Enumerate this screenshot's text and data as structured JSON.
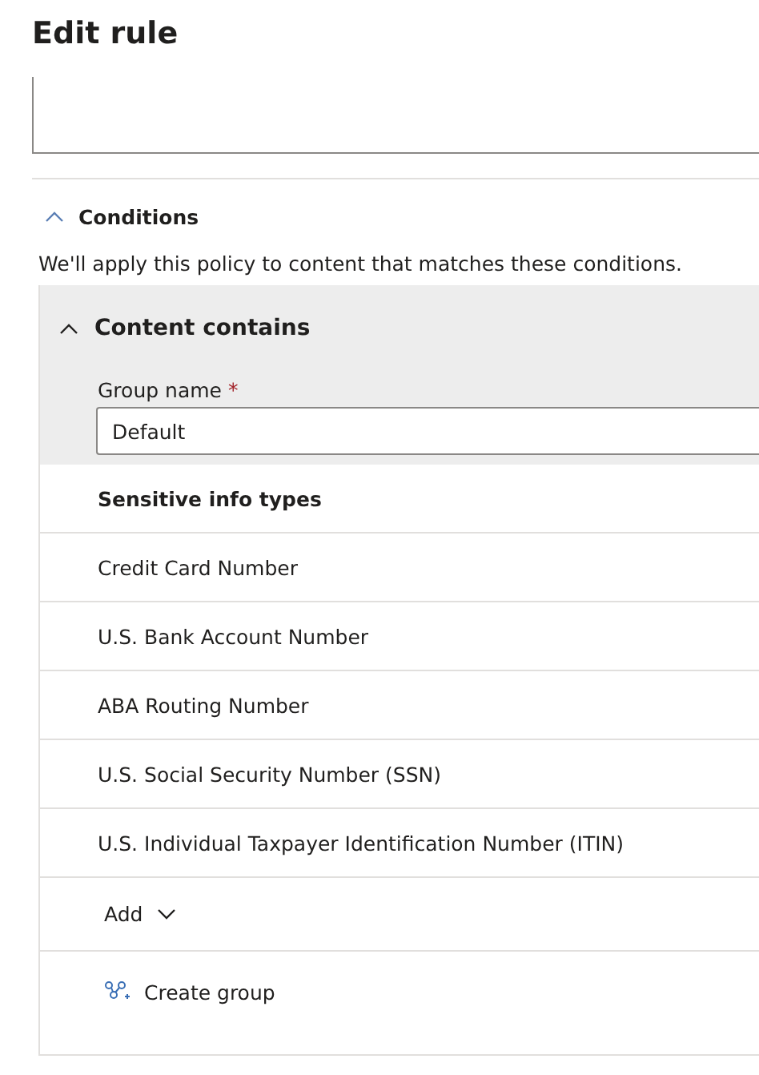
{
  "title": "Edit rule",
  "conditions": {
    "label": "Conditions",
    "expanded": true,
    "description": "We'll apply this policy to content that matches these conditions."
  },
  "content_contains": {
    "label": "Content contains",
    "expanded": true,
    "group_name": {
      "label": "Group name",
      "required_mark": "*",
      "value": "Default"
    },
    "heading": "Sensitive info types",
    "items": [
      "Credit Card Number",
      "U.S. Bank Account Number",
      "ABA Routing Number",
      "U.S. Social Security Number (SSN)",
      "U.S. Individual Taxpayer Identification Number (ITIN)"
    ],
    "add_button": "Add",
    "create_group_button": "Create group"
  }
}
